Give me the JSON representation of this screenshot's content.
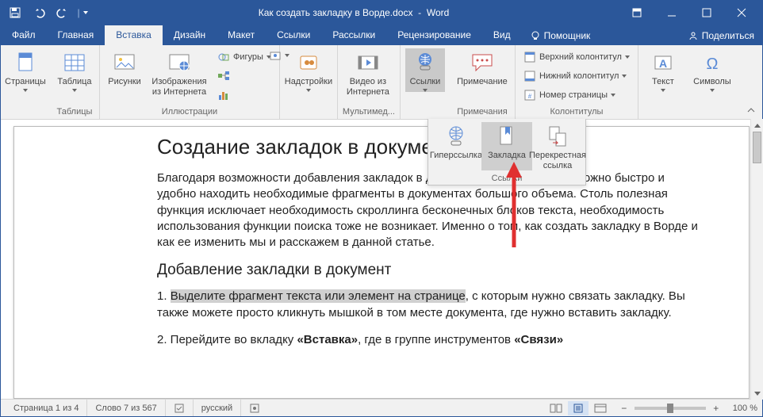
{
  "titlebar": {
    "document_name": "Как создать закладку в Ворде.docx",
    "app_name": "Word"
  },
  "tabs": {
    "file": "Файл",
    "home": "Главная",
    "insert": "Вставка",
    "design": "Дизайн",
    "layout": "Макет",
    "references": "Ссылки",
    "mailings": "Рассылки",
    "review": "Рецензирование",
    "view": "Вид",
    "tell_me": "Помощник",
    "share": "Поделиться"
  },
  "ribbon": {
    "groups": {
      "pages": {
        "label": "",
        "pages_btn": "Страницы"
      },
      "tables": {
        "label": "Таблицы",
        "table_btn": "Таблица"
      },
      "illustrations": {
        "label": "Иллюстрации",
        "pictures": "Рисунки",
        "online_pictures": "Изображения из Интернета",
        "shapes": "Фигуры",
        "smartart": "",
        "chart": "",
        "screenshot": ""
      },
      "addins": {
        "label": "",
        "store": "Надстройки"
      },
      "media": {
        "label": "Мультимед...",
        "online_video": "Видео из Интернета"
      },
      "links": {
        "label": "",
        "links_btn": "Ссылки"
      },
      "comments": {
        "label": "Примечания",
        "comment": "Примечание"
      },
      "header_footer": {
        "label": "Колонтитулы",
        "header": "Верхний колонтитул",
        "footer": "Нижний колонтитул",
        "page_number": "Номер страницы"
      },
      "text": {
        "label": "",
        "text_btn": "Текст"
      },
      "symbols": {
        "label": "",
        "symbols_btn": "Символы"
      }
    }
  },
  "links_popup": {
    "hyperlink": "Гиперссылка",
    "bookmark": "Закладка",
    "crossref": "Перекрестная ссылка",
    "group_label": "Ссылки"
  },
  "document": {
    "h1": "Создание закладок в документе",
    "p1": "Благодаря возможности добавления закладок в документы Microsoft Word, можно быстро и удобно находить необходимые фрагменты в документах большого объема. Столь полезная функция исключает необходимость скроллинга бесконечных блоков текста, необходимость использования функции поиска тоже не возникает. Именно о том, как создать закладку в Ворде и как ее изменить мы и расскажем в данной статье.",
    "h2": "Добавление закладки в документ",
    "li1_pre": "1. ",
    "li1_sel": "Выделите фрагмент текста или элемент на странице",
    "li1_post": ", с которым нужно связать закладку. Вы также можете просто кликнуть мышкой в том месте документа, где нужно вставить закладку.",
    "li2_pre": "2. Перейдите во вкладку ",
    "li2_b1": "«Вставка»",
    "li2_mid": ", где в группе инструментов ",
    "li2_b2": "«Связи»"
  },
  "statusbar": {
    "page": "Страница 1 из 4",
    "words": "Слово 7 из 567",
    "lang": "русский",
    "zoom": "100 %"
  },
  "colors": {
    "brand": "#2b579a"
  }
}
